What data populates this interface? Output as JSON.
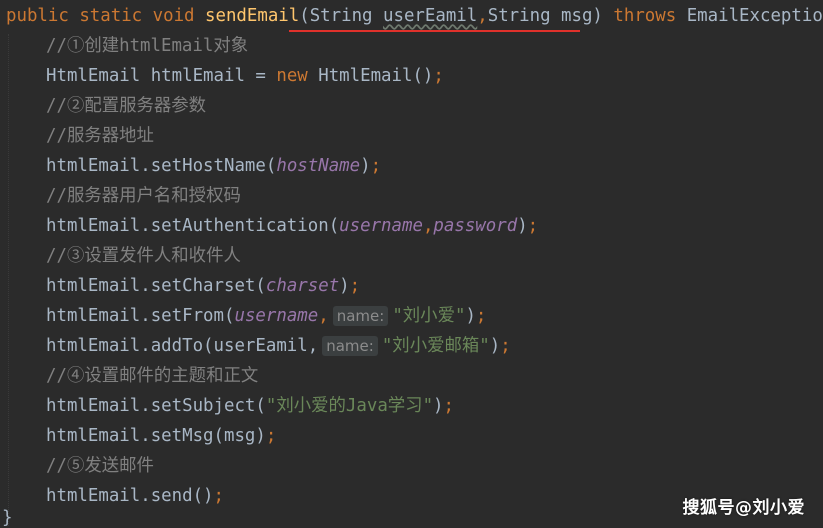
{
  "colors": {
    "background": "#2b2b2b",
    "keyword": "#cc7832",
    "method_name": "#ffc66d",
    "comment": "#808080",
    "parameter": "#9876aa",
    "string": "#6a8759",
    "default_text": "#a9b7c6",
    "red_underline": "#e0312b"
  },
  "code": {
    "signature": {
      "kw_public": "public",
      "kw_static": "static",
      "kw_void": "void",
      "method": "sendEmail",
      "params_open": "(String ",
      "param1": "userEamil",
      "params_sep": ",",
      "params_rest": "String msg)",
      "kw_throws": "throws",
      "exception": "EmailException",
      "open_brace": "{"
    },
    "line1_comment": "//①创建htmlEmail对象",
    "line2": {
      "type": "HtmlEmail htmlEmail = ",
      "kw_new": "new",
      "ctor": " HtmlEmail()",
      "semi": ";"
    },
    "line3_comment": "//②配置服务器参数",
    "line4_comment": "//服务器地址",
    "line5": {
      "call": "htmlEmail.setHostName(",
      "arg": "hostName",
      "close": ")",
      "semi": ";"
    },
    "line6_comment": "//服务器用户名和授权码",
    "line7": {
      "call": "htmlEmail.setAuthentication(",
      "arg1": "username",
      "sep": ",",
      "arg2": "password",
      "close": ")",
      "semi": ";"
    },
    "line8_comment": "//③设置发件人和收件人",
    "line9": {
      "call": "htmlEmail.setCharset(",
      "arg": "charset",
      "close": ")",
      "semi": ";"
    },
    "line10": {
      "call": "htmlEmail.setFrom(",
      "arg": "username",
      "sep": ",",
      "hint": "name:",
      "str": "\"刘小爱\"",
      "close": ")",
      "semi": ";"
    },
    "line11": {
      "call": "htmlEmail.addTo(userEamil,",
      "hint": "name:",
      "str": "\"刘小爱邮箱\"",
      "close": ")",
      "semi": ";"
    },
    "line12_comment": "//④设置邮件的主题和正文",
    "line13": {
      "call": "htmlEmail.setSubject(",
      "str": "\"刘小爱的Java学习\"",
      "close": ")",
      "semi": ";"
    },
    "line14": {
      "call": "htmlEmail.setMsg(msg)",
      "semi": ";"
    },
    "line15_comment": "//⑤发送邮件",
    "line16": {
      "call": "htmlEmail.send()",
      "semi": ";"
    },
    "closing_brace": "}"
  },
  "watermark": "搜狐号@刘小爱"
}
